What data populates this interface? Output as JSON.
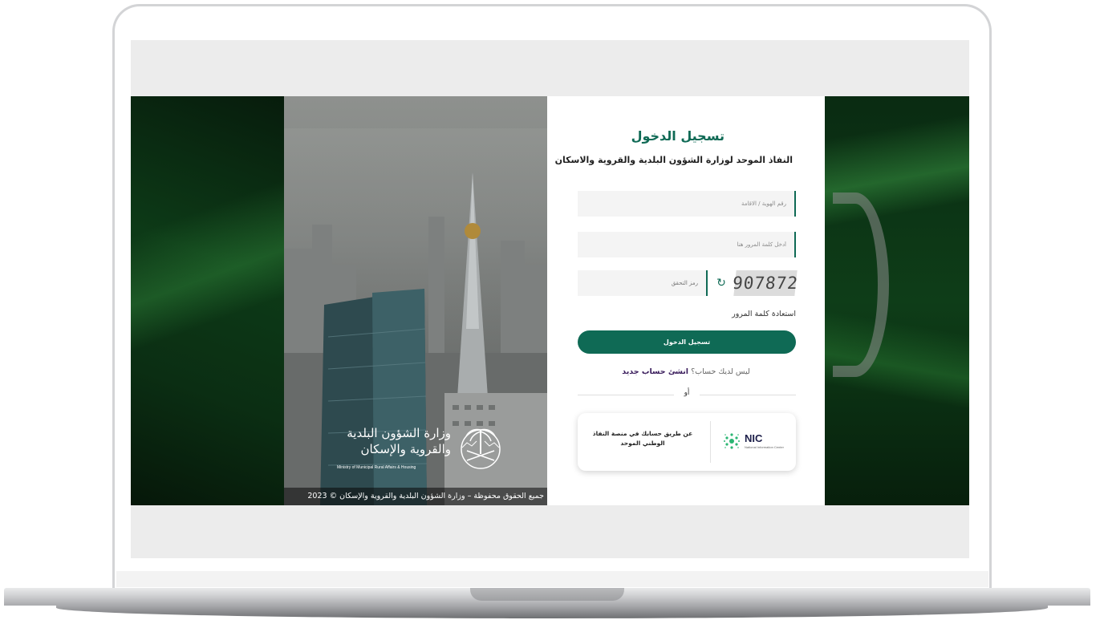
{
  "copyright": "جميع الحقوق محفوظة – وزارة الشؤون البلدية والقروية والإسكان © 2023",
  "ministry": {
    "name_line1": "وزارة الشؤون البلدية",
    "name_line2": "والقروية والإسكان",
    "name_en": "Ministry of Municipal Rural Affairs & Housing"
  },
  "login": {
    "title": "تسجيل الدخول",
    "subtitle": "النفاذ الموحد لوزارة الشؤون البلدية والقروية والاسكان",
    "id_placeholder": "رقم الهوية / الاقامة",
    "password_placeholder": "أدخل كلمة المرور هنا",
    "captcha_placeholder": "رمز التحقق",
    "captcha_code": "907872",
    "forgot_password": "استعادة كلمة المرور",
    "login_button": "تسجيل الدخول",
    "no_account": "ليس لديك حساب؟",
    "create_account": "انشئ حساب جديد",
    "or": "أو",
    "nafath_text": "عن طريق حسابك في منصة النفاذ الوطني الموحد",
    "nic_name": "NIC",
    "nic_sub": "National Information Center"
  },
  "colors": {
    "primary": "#0f6a55",
    "link": "#3a1d5c"
  }
}
